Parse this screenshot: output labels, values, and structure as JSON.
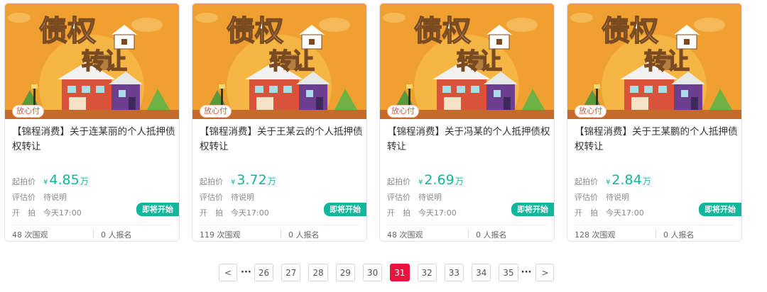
{
  "cards": [
    {
      "badge": "放心付",
      "banner_text_1": "债权",
      "banner_text_2": "转让",
      "title": "【锦程消费】关于连某丽的个人抵押债权转让",
      "start_label": "起拍价",
      "currency": "¥",
      "price": "4.85",
      "unit": "万",
      "eval_label": "评估价",
      "eval_value": "待说明",
      "open_label": "开　拍",
      "open_value": "今天17:00",
      "status": "即将开始",
      "views": "48 次围观",
      "signups": "0 人报名"
    },
    {
      "badge": "放心付",
      "banner_text_1": "债权",
      "banner_text_2": "转让",
      "title": "【锦程消费】关于王某云的个人抵押债权转让",
      "start_label": "起拍价",
      "currency": "¥",
      "price": "3.72",
      "unit": "万",
      "eval_label": "评估价",
      "eval_value": "待说明",
      "open_label": "开　拍",
      "open_value": "今天17:00",
      "status": "即将开始",
      "views": "119 次围观",
      "signups": "0 人报名"
    },
    {
      "badge": "放心付",
      "banner_text_1": "债权",
      "banner_text_2": "转让",
      "title": "【锦程消费】关于冯某的个人抵押债权转让",
      "start_label": "起拍价",
      "currency": "¥",
      "price": "2.69",
      "unit": "万",
      "eval_label": "评估价",
      "eval_value": "待说明",
      "open_label": "开　拍",
      "open_value": "今天17:00",
      "status": "即将开始",
      "views": "48 次围观",
      "signups": "0 人报名"
    },
    {
      "badge": "放心付",
      "banner_text_1": "债权",
      "banner_text_2": "转让",
      "title": "【锦程消费】关于王某鹏的个人抵押债权转让",
      "start_label": "起拍价",
      "currency": "¥",
      "price": "2.84",
      "unit": "万",
      "eval_label": "评估价",
      "eval_value": "待说明",
      "open_label": "开　拍",
      "open_value": "今天17:00",
      "status": "即将开始",
      "views": "128 次围观",
      "signups": "0 人报名"
    }
  ],
  "pagination": {
    "prev": "<",
    "next": ">",
    "ellipsis": "···",
    "pages": [
      "26",
      "27",
      "28",
      "29",
      "30",
      "31",
      "32",
      "33",
      "34",
      "35"
    ],
    "current": "31"
  },
  "colors": {
    "accent": "#13b59b",
    "active_page": "#e8133f",
    "banner_bg": "#f0a031"
  }
}
